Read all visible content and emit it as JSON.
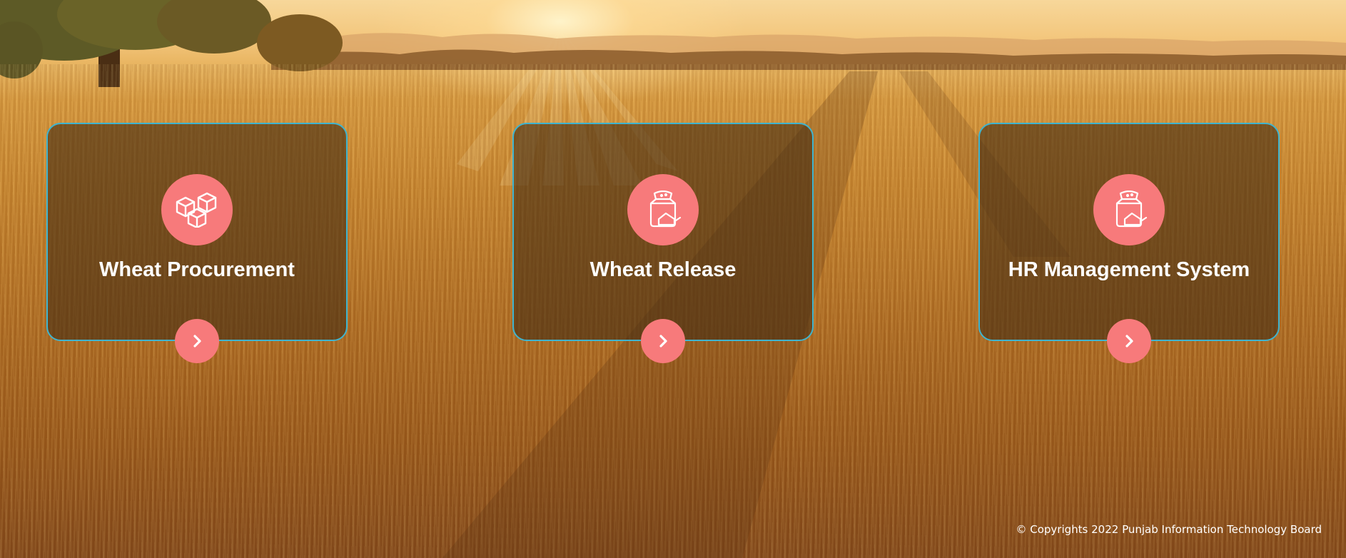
{
  "cards": [
    {
      "title": "Wheat Procurement",
      "icon": "boxes-icon",
      "arrow_icon": "chevron-right-icon"
    },
    {
      "title": "Wheat Release",
      "icon": "flour-sack-icon",
      "arrow_icon": "chevron-right-icon"
    },
    {
      "title": "HR Management System",
      "icon": "flour-sack-icon",
      "arrow_icon": "chevron-right-icon"
    }
  ],
  "footer": {
    "copyright": "© Copyrights 2022 Punjab Information Technology Board"
  },
  "colors": {
    "accent": "#f77a7b",
    "card_border": "#3fb4cf",
    "card_overlay": "#462d14",
    "text": "#ffffff"
  },
  "background": "wheat-field-sunset"
}
